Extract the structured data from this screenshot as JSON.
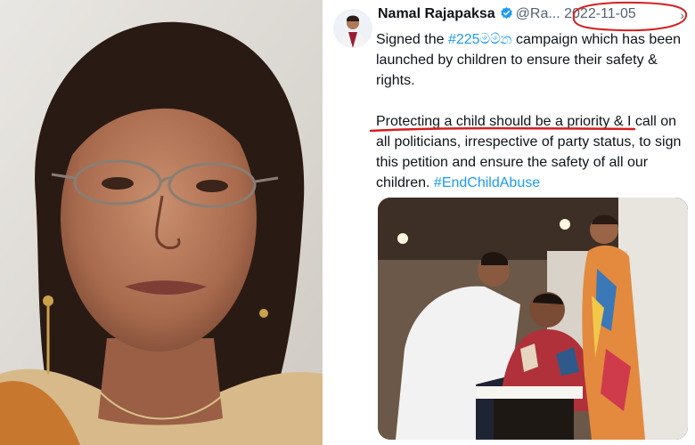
{
  "tweet": {
    "author_name": "Namal Rajapaksa",
    "handle": "@Ra...",
    "date": "2022-11-05",
    "more_icon": "chevron-right-icon",
    "verified_icon": "verified-badge-icon",
    "text": {
      "line1_prefix": "Signed the ",
      "hashtag1": "#225",
      "hashtag1_sinhala": "මම්න",
      "line1_suffix": " campaign which has been launched by children to ensure their safety & rights.",
      "para2_highlight": "Protecting a child should be a priority",
      "para2_rest": " & I call on all politicians, irrespective of party status, to sign this petition and ensure the safety of all our children. ",
      "hashtag2": "#EndChildAbuse"
    }
  },
  "colors": {
    "link": "#1d9bf0",
    "annotation_red": "#d42020",
    "text_primary": "#0f1419",
    "text_secondary": "#536471"
  }
}
